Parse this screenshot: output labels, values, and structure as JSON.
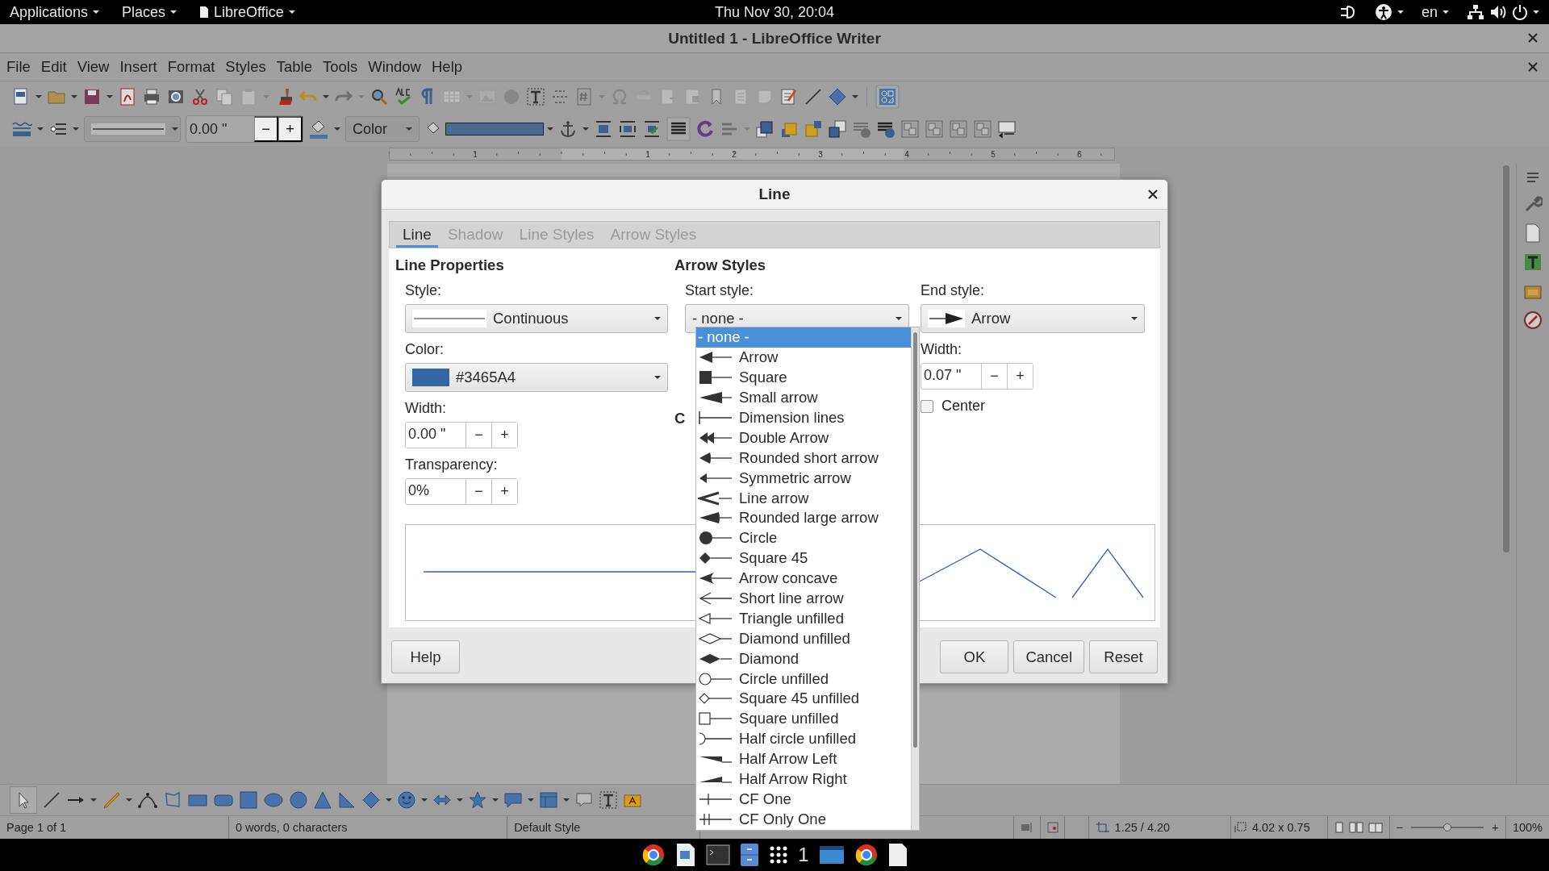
{
  "top_bar": {
    "menus": [
      {
        "label": "Applications"
      },
      {
        "label": "Places"
      },
      {
        "label": "LibreOffice"
      }
    ],
    "clock": "Thu Nov 30, 20:04",
    "language": "en"
  },
  "window": {
    "title": "Untitled 1 - LibreOffice Writer"
  },
  "menu_bar": [
    "File",
    "Edit",
    "View",
    "Insert",
    "Format",
    "Styles",
    "Table",
    "Tools",
    "Window",
    "Help"
  ],
  "format_toolbar": {
    "line_width": {
      "value": "0.00 \"",
      "decrement": "−",
      "increment": "+"
    },
    "area_style": "Color"
  },
  "ruler": {
    "labels": [
      "1",
      "1",
      "2",
      "3",
      "4",
      "5",
      "6"
    ]
  },
  "dialog": {
    "title": "Line",
    "tabs": [
      {
        "label": "Line",
        "selected": true
      },
      {
        "label": "Shadow",
        "selected": false
      },
      {
        "label": "Line Styles",
        "selected": false
      },
      {
        "label": "Arrow Styles",
        "selected": false
      }
    ],
    "line_properties": {
      "heading": "Line Properties",
      "style_label": "Style:",
      "style": "Continuous",
      "color_label": "Color:",
      "color": "#3465A4",
      "width_label": "Width:",
      "width": {
        "value": "0.00 \"",
        "decrement": "−",
        "increment": "+"
      },
      "transparency_label": "Transparency:",
      "transparency": {
        "value": "0%",
        "decrement": "−",
        "increment": "+"
      }
    },
    "arrow_styles": {
      "heading": "Arrow Styles",
      "start_label": "Start style:",
      "start_style": "- none -",
      "covered_label_fragment": "C",
      "end_label": "End style:",
      "end_style": "Arrow",
      "width_label": "Width:",
      "width": {
        "value": "0.07 \"",
        "decrement": "−",
        "increment": "+"
      },
      "center": {
        "label": "Center",
        "checked": false
      }
    },
    "buttons": {
      "help": "Help",
      "ok": "OK",
      "cancel": "Cancel",
      "reset": "Reset"
    }
  },
  "start_style_list": {
    "items": [
      {
        "label": "- none -",
        "kind": "none",
        "selected": true
      },
      {
        "label": "Arrow",
        "kind": "arrow",
        "selected": false
      },
      {
        "label": "Square",
        "kind": "square",
        "selected": false
      },
      {
        "label": "Small arrow",
        "kind": "smallarrow",
        "selected": false
      },
      {
        "label": "Dimension lines",
        "kind": "dimension",
        "selected": false
      },
      {
        "label": "Double Arrow",
        "kind": "doublearrow",
        "selected": false
      },
      {
        "label": "Rounded short arrow",
        "kind": "roundedshort",
        "selected": false
      },
      {
        "label": "Symmetric arrow",
        "kind": "symmetric",
        "selected": false
      },
      {
        "label": "Line arrow",
        "kind": "linearrow",
        "selected": false
      },
      {
        "label": "Rounded large arrow",
        "kind": "roundedlarge",
        "selected": false
      },
      {
        "label": "Circle",
        "kind": "circle",
        "selected": false
      },
      {
        "label": "Square 45",
        "kind": "square45",
        "selected": false
      },
      {
        "label": "Arrow concave",
        "kind": "concave",
        "selected": false
      },
      {
        "label": "Short line arrow",
        "kind": "shortline",
        "selected": false
      },
      {
        "label": "Triangle unfilled",
        "kind": "triangleopen",
        "selected": false
      },
      {
        "label": "Diamond unfilled",
        "kind": "diamondopen",
        "selected": false
      },
      {
        "label": "Diamond",
        "kind": "diamond",
        "selected": false
      },
      {
        "label": "Circle unfilled",
        "kind": "circleopen",
        "selected": false
      },
      {
        "label": "Square 45 unfilled",
        "kind": "square45open",
        "selected": false
      },
      {
        "label": "Square unfilled",
        "kind": "squareopen",
        "selected": false
      },
      {
        "label": "Half circle unfilled",
        "kind": "halfcircleopen",
        "selected": false
      },
      {
        "label": "Half Arrow Left",
        "kind": "halfleft",
        "selected": false
      },
      {
        "label": "Half Arrow Right",
        "kind": "halfright",
        "selected": false
      },
      {
        "label": "CF One",
        "kind": "cfone",
        "selected": false
      },
      {
        "label": "CF Only One",
        "kind": "cfonlyone",
        "selected": false
      }
    ]
  },
  "status_bar": {
    "page": "Page 1 of 1",
    "words": "0 words, 0 characters",
    "page_style": "Default Style",
    "position": "1.25 / 4.20",
    "size": "4.02 x 0.75",
    "zoom_out": "−",
    "zoom_in": "+",
    "zoom": {
      "level": 0.5
    },
    "zoom_percent": "100%"
  },
  "taskbar": {
    "workspace": "1"
  }
}
